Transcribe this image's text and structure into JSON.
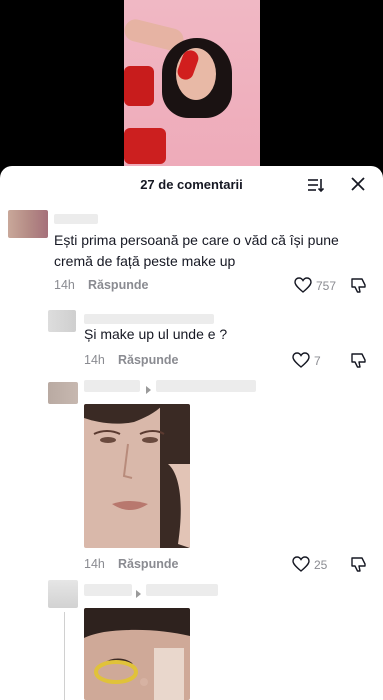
{
  "header": {
    "title": "27 de comentarii"
  },
  "comments": [
    {
      "text": "Ești prima persoană pe care o văd că își pune cremă de față peste make up",
      "time": "14h",
      "reply_label": "Răspunde",
      "likes": "757"
    },
    {
      "text": "Și make up ul unde e ?",
      "time": "14h",
      "reply_label": "Răspunde",
      "likes": "7"
    },
    {
      "time": "14h",
      "reply_label": "Răspunde",
      "likes": "25"
    }
  ],
  "icons": {
    "sort": "sort-icon",
    "close": "close-icon",
    "like": "heart-icon",
    "dislike": "thumbs-down-icon",
    "reply_arrow": "reply-arrow-icon"
  }
}
